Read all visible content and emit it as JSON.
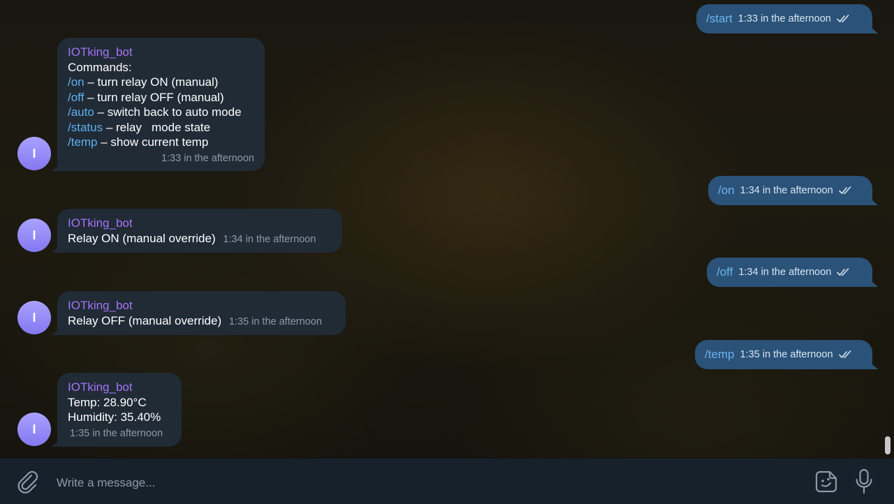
{
  "bot_name": "IOTking_bot",
  "avatar_letter": "I",
  "outgoing": [
    {
      "text": "/start",
      "time": "1:33 in the afternoon"
    },
    {
      "text": "/on",
      "time": "1:34 in the afternoon"
    },
    {
      "text": "/off",
      "time": "1:34 in the afternoon"
    },
    {
      "text": "/temp",
      "time": "1:35 in the afternoon"
    }
  ],
  "help_message": {
    "title": "Commands:",
    "lines": [
      {
        "cmd": "/on",
        "desc": " – turn relay ON (manual)"
      },
      {
        "cmd": "/off",
        "desc": " – turn relay OFF (manual)"
      },
      {
        "cmd": "/auto",
        "desc": " – switch back to auto mode"
      },
      {
        "cmd": "/status",
        "desc": " – relay   mode state"
      },
      {
        "cmd": "/temp",
        "desc": " – show current temp"
      }
    ],
    "time": "1:33 in the afternoon"
  },
  "relay_on_message": {
    "text": "Relay ON (manual override)",
    "time": "1:34 in the afternoon"
  },
  "relay_off_message": {
    "text": "Relay OFF (manual override)",
    "time": "1:35 in the afternoon"
  },
  "temp_message": {
    "line1": "Temp: 28.90°C",
    "line2": "Humidity: 35.40%",
    "time": "1:35 in the afternoon"
  },
  "composer": {
    "placeholder": "Write a message..."
  },
  "icons": {
    "attach": "paperclip-icon",
    "emoji": "sticker-emoji-icon",
    "mic": "microphone-icon",
    "read": "double-check-icon"
  },
  "colors": {
    "incoming_bubble": "#202b36",
    "outgoing_bubble": "#2b5278",
    "sender_name": "#a673f5",
    "command_link": "#5fb0ef",
    "avatar": "#8f85f5",
    "composer_bg": "#17212b"
  }
}
